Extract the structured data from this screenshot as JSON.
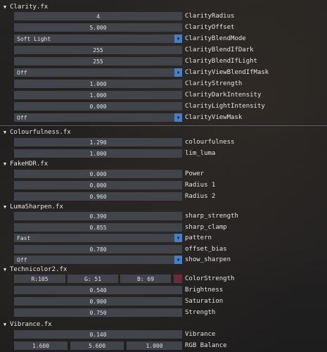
{
  "sections": {
    "clarity": {
      "title": "Clarity.fx",
      "rows": [
        {
          "value": "4",
          "label": "ClarityRadius"
        },
        {
          "value": "5.000",
          "label": "ClarityOffset"
        },
        {
          "value": "Soft Light",
          "label": "ClarityBlendMode"
        },
        {
          "value": "255",
          "label": "ClarityBlendIfDark"
        },
        {
          "value": "255",
          "label": "ClarityBlendIfLight"
        },
        {
          "value": "Off",
          "label": "ClarityViewBlendIfMask"
        },
        {
          "value": "1.000",
          "label": "ClarityStrength"
        },
        {
          "value": "1.000",
          "label": "ClarityDarkIntensity"
        },
        {
          "value": "0.000",
          "label": "ClarityLightIntensity"
        },
        {
          "value": "Off",
          "label": "ClarityViewMask"
        }
      ]
    },
    "colourfulness": {
      "title": "Colourfulness.fx",
      "rows": [
        {
          "value": "1.290",
          "label": "colourfulness"
        },
        {
          "value": "1.000",
          "label": "lim_luma"
        }
      ]
    },
    "fakehdr": {
      "title": "FakeHDR.fx",
      "rows": [
        {
          "value": "0.000",
          "label": "Power"
        },
        {
          "value": "0.000",
          "label": "Radius 1"
        },
        {
          "value": "0.960",
          "label": "Radius 2"
        }
      ]
    },
    "lumasharpen": {
      "title": "LumaSharpen.fx",
      "rows": [
        {
          "value": "0.390",
          "label": "sharp_strength"
        },
        {
          "value": "0.855",
          "label": "sharp_clamp"
        },
        {
          "value": "Fast",
          "label": "pattern"
        },
        {
          "value": "0.780",
          "label": "offset_bias"
        },
        {
          "value": "Off",
          "label": "show_sharpen"
        }
      ]
    },
    "technicolor2": {
      "title": "Technicolor2.fx",
      "color_strength": {
        "r": "R:105",
        "g": "G: 51",
        "b": "B: 69",
        "label": "ColorStrength",
        "swatch": "#692c3a"
      },
      "rows": [
        {
          "value": "0.540",
          "label": "Brightness"
        },
        {
          "value": "0.900",
          "label": "Saturation"
        },
        {
          "value": "0.750",
          "label": "Strength"
        }
      ]
    },
    "vibrance": {
      "title": "Vibrance.fx",
      "rows": [
        {
          "value": "0.140",
          "label": "Vibrance"
        }
      ],
      "rgb_balance": {
        "v1": "1.600",
        "v2": "5.600",
        "v3": "1.000",
        "label": "RGB Balance"
      }
    }
  },
  "colors": {
    "accent": "#4a7fbf",
    "field_bg": "#464a52"
  }
}
